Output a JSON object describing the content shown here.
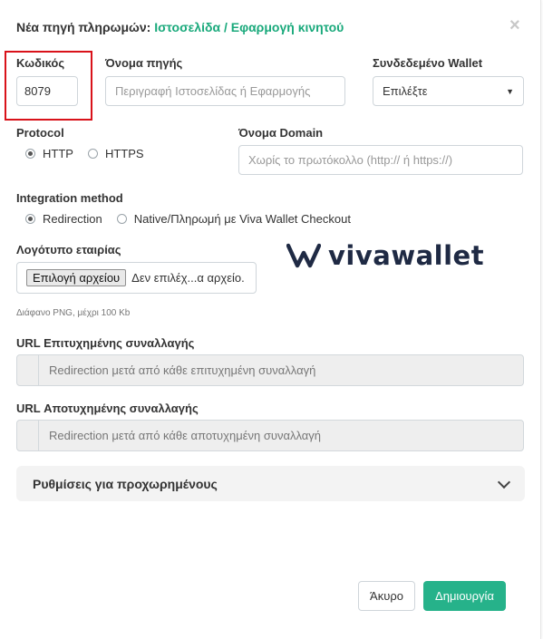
{
  "modal": {
    "title_prefix": "Νέα πηγή πληρωμών:",
    "title_accent": "Ιστοσελίδα / Εφαρμογή κινητού",
    "close_icon": "×"
  },
  "fields": {
    "code": {
      "label": "Κωδικός",
      "value": "8079"
    },
    "source_name": {
      "label": "Όνομα πηγής",
      "placeholder": "Περιγραφή Ιστοσελίδας ή Εφαρμογής"
    },
    "wallet": {
      "label": "Συνδεδεμένο Wallet",
      "selected": "Επιλέξτε"
    },
    "protocol": {
      "label": "Protocol",
      "options": [
        "HTTP",
        "HTTPS"
      ],
      "selected": "HTTP"
    },
    "domain": {
      "label": "Όνομα Domain",
      "placeholder": "Χωρίς το πρωτόκολλο (http:// ή https://)"
    },
    "integration": {
      "label": "Integration method",
      "options": [
        "Redirection",
        "Native/Πληρωμή με Viva Wallet Checkout"
      ],
      "selected": "Redirection"
    },
    "logo": {
      "label": "Λογότυπο εταιρίας",
      "button": "Επιλογή αρχείου",
      "status": "Δεν επιλέχ...α αρχείο.",
      "hint": "Διάφανο PNG, μέχρι 100 Kb"
    },
    "success_url": {
      "label": "URL Επιτυχημένης συναλλαγής",
      "placeholder": "Redirection μετά από κάθε επιτυχημένη συναλλαγή"
    },
    "fail_url": {
      "label": "URL Αποτυχημένης συναλλαγής",
      "placeholder": "Redirection μετά από κάθε αποτυχημένη συναλλαγή"
    }
  },
  "brand": {
    "logo_text": "vivawallet",
    "logo_icon": "viva-v-icon",
    "color": "#1f2a44"
  },
  "advanced": {
    "label": "Ρυθμίσεις για προχωρημένους",
    "icon": "chevron-down-icon"
  },
  "actions": {
    "cancel": "Άκυρο",
    "create": "Δημιουργία"
  },
  "colors": {
    "accent": "#19a97b",
    "primary_button": "#26b28a",
    "highlight": "#d9121a"
  }
}
